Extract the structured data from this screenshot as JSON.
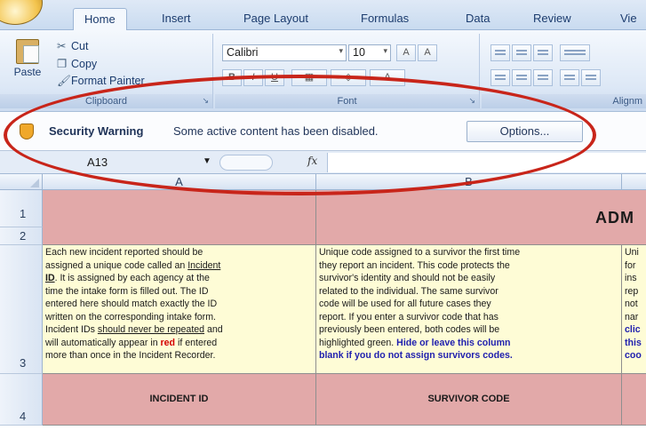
{
  "ribbon": {
    "tabs": [
      "Home",
      "Insert",
      "Page Layout",
      "Formulas",
      "Data",
      "Review",
      "Vie"
    ],
    "clipboard": {
      "paste": "Paste",
      "cut": "Cut",
      "copy": "Copy",
      "format_painter": "Format Painter",
      "label": "Clipboard"
    },
    "font": {
      "name": "Calibri",
      "size": "10",
      "label": "Font"
    },
    "alignment_label": "Alignm"
  },
  "security": {
    "title": "Security Warning",
    "message": "Some active content has been disabled.",
    "options_button": "Options..."
  },
  "formula_bar": {
    "name_box": "A13",
    "fx": "fx",
    "value": ""
  },
  "grid": {
    "columns": [
      "A",
      "B"
    ],
    "rows": [
      "1",
      "2",
      "3",
      "4"
    ],
    "title_fragment": "ADM",
    "col_a_desc": {
      "line1": "Each new incident reported should be",
      "line2a": "assigned a unique code called an ",
      "line2b": "Incident",
      "line3a": "ID",
      "line3b": ". It is assigned by each agency at the",
      "line4": "time the intake form is filled out. The ID",
      "line5": "entered here should match exactly the ID",
      "line6": "written on the corresponding intake form.",
      "line7a": "Incident IDs ",
      "line7b": "should never be repeated",
      "line7c": " and",
      "line8a": "will automatically appear in ",
      "line8b": "red",
      "line8c": " if entered",
      "line9": "more than once in the Incident Recorder."
    },
    "col_b_desc": {
      "line1": "Unique code assigned to a survivor the first time",
      "line2": "they report an incident.  This code protects the",
      "line3": "survivor's identity and should not be easily",
      "line4": "related to the individual. The same survivor",
      "line5": "code will be used for all future cases they",
      "line6": "report.  If you enter a survivor code that has",
      "line7": "previously been entered, both codes will be",
      "line8a": "highlighted green.  ",
      "line8b": "Hide or leave this column",
      "line9": "blank if you do not assign survivors codes."
    },
    "col_c_fragments": [
      "Uni",
      "for",
      "ins",
      "rep",
      "not",
      "nar",
      "clic",
      "this",
      "coo"
    ],
    "headers": {
      "incident_id": "INCIDENT ID",
      "survivor_code": "SURVIVOR CODE"
    }
  },
  "colors": {
    "header_pink": "#e2a9a9",
    "desc_yellow": "#fefcd6",
    "annotation_red": "#c8251a"
  }
}
